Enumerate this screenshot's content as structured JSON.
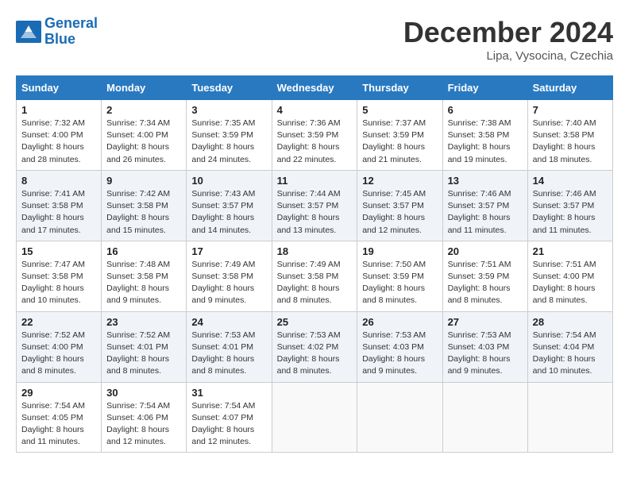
{
  "logo": {
    "line1": "General",
    "line2": "Blue"
  },
  "title": "December 2024",
  "location": "Lipa, Vysocina, Czechia",
  "weekdays": [
    "Sunday",
    "Monday",
    "Tuesday",
    "Wednesday",
    "Thursday",
    "Friday",
    "Saturday"
  ],
  "weeks": [
    [
      {
        "day": "1",
        "info": "Sunrise: 7:32 AM\nSunset: 4:00 PM\nDaylight: 8 hours\nand 28 minutes."
      },
      {
        "day": "2",
        "info": "Sunrise: 7:34 AM\nSunset: 4:00 PM\nDaylight: 8 hours\nand 26 minutes."
      },
      {
        "day": "3",
        "info": "Sunrise: 7:35 AM\nSunset: 3:59 PM\nDaylight: 8 hours\nand 24 minutes."
      },
      {
        "day": "4",
        "info": "Sunrise: 7:36 AM\nSunset: 3:59 PM\nDaylight: 8 hours\nand 22 minutes."
      },
      {
        "day": "5",
        "info": "Sunrise: 7:37 AM\nSunset: 3:59 PM\nDaylight: 8 hours\nand 21 minutes."
      },
      {
        "day": "6",
        "info": "Sunrise: 7:38 AM\nSunset: 3:58 PM\nDaylight: 8 hours\nand 19 minutes."
      },
      {
        "day": "7",
        "info": "Sunrise: 7:40 AM\nSunset: 3:58 PM\nDaylight: 8 hours\nand 18 minutes."
      }
    ],
    [
      {
        "day": "8",
        "info": "Sunrise: 7:41 AM\nSunset: 3:58 PM\nDaylight: 8 hours\nand 17 minutes."
      },
      {
        "day": "9",
        "info": "Sunrise: 7:42 AM\nSunset: 3:58 PM\nDaylight: 8 hours\nand 15 minutes."
      },
      {
        "day": "10",
        "info": "Sunrise: 7:43 AM\nSunset: 3:57 PM\nDaylight: 8 hours\nand 14 minutes."
      },
      {
        "day": "11",
        "info": "Sunrise: 7:44 AM\nSunset: 3:57 PM\nDaylight: 8 hours\nand 13 minutes."
      },
      {
        "day": "12",
        "info": "Sunrise: 7:45 AM\nSunset: 3:57 PM\nDaylight: 8 hours\nand 12 minutes."
      },
      {
        "day": "13",
        "info": "Sunrise: 7:46 AM\nSunset: 3:57 PM\nDaylight: 8 hours\nand 11 minutes."
      },
      {
        "day": "14",
        "info": "Sunrise: 7:46 AM\nSunset: 3:57 PM\nDaylight: 8 hours\nand 11 minutes."
      }
    ],
    [
      {
        "day": "15",
        "info": "Sunrise: 7:47 AM\nSunset: 3:58 PM\nDaylight: 8 hours\nand 10 minutes."
      },
      {
        "day": "16",
        "info": "Sunrise: 7:48 AM\nSunset: 3:58 PM\nDaylight: 8 hours\nand 9 minutes."
      },
      {
        "day": "17",
        "info": "Sunrise: 7:49 AM\nSunset: 3:58 PM\nDaylight: 8 hours\nand 9 minutes."
      },
      {
        "day": "18",
        "info": "Sunrise: 7:49 AM\nSunset: 3:58 PM\nDaylight: 8 hours\nand 8 minutes."
      },
      {
        "day": "19",
        "info": "Sunrise: 7:50 AM\nSunset: 3:59 PM\nDaylight: 8 hours\nand 8 minutes."
      },
      {
        "day": "20",
        "info": "Sunrise: 7:51 AM\nSunset: 3:59 PM\nDaylight: 8 hours\nand 8 minutes."
      },
      {
        "day": "21",
        "info": "Sunrise: 7:51 AM\nSunset: 4:00 PM\nDaylight: 8 hours\nand 8 minutes."
      }
    ],
    [
      {
        "day": "22",
        "info": "Sunrise: 7:52 AM\nSunset: 4:00 PM\nDaylight: 8 hours\nand 8 minutes."
      },
      {
        "day": "23",
        "info": "Sunrise: 7:52 AM\nSunset: 4:01 PM\nDaylight: 8 hours\nand 8 minutes."
      },
      {
        "day": "24",
        "info": "Sunrise: 7:53 AM\nSunset: 4:01 PM\nDaylight: 8 hours\nand 8 minutes."
      },
      {
        "day": "25",
        "info": "Sunrise: 7:53 AM\nSunset: 4:02 PM\nDaylight: 8 hours\nand 8 minutes."
      },
      {
        "day": "26",
        "info": "Sunrise: 7:53 AM\nSunset: 4:03 PM\nDaylight: 8 hours\nand 9 minutes."
      },
      {
        "day": "27",
        "info": "Sunrise: 7:53 AM\nSunset: 4:03 PM\nDaylight: 8 hours\nand 9 minutes."
      },
      {
        "day": "28",
        "info": "Sunrise: 7:54 AM\nSunset: 4:04 PM\nDaylight: 8 hours\nand 10 minutes."
      }
    ],
    [
      {
        "day": "29",
        "info": "Sunrise: 7:54 AM\nSunset: 4:05 PM\nDaylight: 8 hours\nand 11 minutes."
      },
      {
        "day": "30",
        "info": "Sunrise: 7:54 AM\nSunset: 4:06 PM\nDaylight: 8 hours\nand 12 minutes."
      },
      {
        "day": "31",
        "info": "Sunrise: 7:54 AM\nSunset: 4:07 PM\nDaylight: 8 hours\nand 12 minutes."
      },
      null,
      null,
      null,
      null
    ]
  ]
}
